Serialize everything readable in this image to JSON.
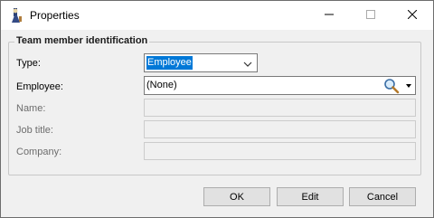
{
  "window": {
    "title": "Properties"
  },
  "group": {
    "title": "Team member identification"
  },
  "fields": {
    "type": {
      "label": "Type:",
      "value": "Employee"
    },
    "employee": {
      "label": "Employee:",
      "value": "(None)"
    },
    "name": {
      "label": "Name:",
      "value": ""
    },
    "job_title": {
      "label": "Job title:",
      "value": ""
    },
    "company": {
      "label": "Company:",
      "value": ""
    }
  },
  "buttons": {
    "ok": "OK",
    "edit": "Edit",
    "cancel": "Cancel"
  },
  "icons": {
    "app": "app-icon",
    "minimize": "minimize-icon",
    "maximize": "maximize-icon",
    "close": "close-icon",
    "search": "search-icon",
    "dropdown": "dropdown-icon"
  },
  "colors": {
    "selection": "#0078d7"
  }
}
